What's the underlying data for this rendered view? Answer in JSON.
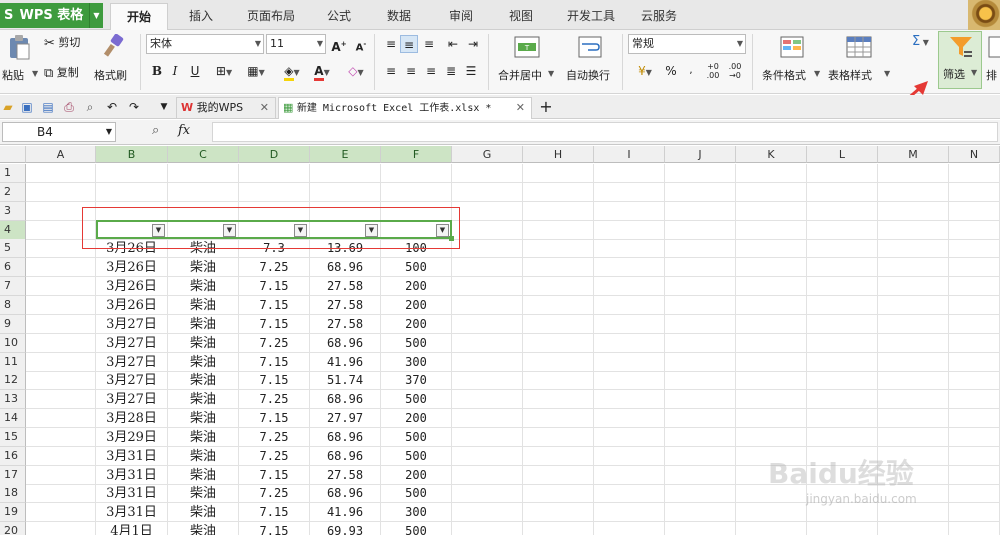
{
  "app": {
    "name": "WPS 表格"
  },
  "menu_tabs": [
    "开始",
    "插入",
    "页面布局",
    "公式",
    "数据",
    "审阅",
    "视图",
    "开发工具",
    "云服务"
  ],
  "ribbon": {
    "paste": "粘贴",
    "cut": "剪切",
    "copy": "复制",
    "format_painter": "格式刷",
    "font_name": "宋体",
    "font_size": "11",
    "merge_center": "合并居中",
    "wrap_text": "自动换行",
    "number_format": "常规",
    "conditional_format": "条件格式",
    "table_style": "表格样式",
    "sum_symbol": "Σ",
    "filter": "筛选",
    "sort": "排"
  },
  "quickbar": {
    "doc_tabs": [
      "我的WPS",
      "新建 Microsoft Excel 工作表.xlsx *"
    ],
    "add_tab": "+"
  },
  "formula_bar": {
    "cell_ref": "B4",
    "fx": "fx"
  },
  "grid": {
    "columns": [
      "A",
      "B",
      "C",
      "D",
      "E",
      "F",
      "G",
      "H",
      "I",
      "J",
      "K",
      "L",
      "M",
      "N"
    ],
    "rows": [
      "1",
      "2",
      "3",
      "4",
      "5",
      "6",
      "7",
      "8",
      "9",
      "10",
      "11",
      "12",
      "13",
      "14",
      "15",
      "16",
      "17",
      "18",
      "19",
      "20"
    ],
    "data_rows": [
      [
        "3月26日",
        "柴油",
        "7.3",
        "13.69",
        "100"
      ],
      [
        "3月26日",
        "柴油",
        "7.25",
        "68.96",
        "500"
      ],
      [
        "3月26日",
        "柴油",
        "7.15",
        "27.58",
        "200"
      ],
      [
        "3月26日",
        "柴油",
        "7.15",
        "27.58",
        "200"
      ],
      [
        "3月27日",
        "柴油",
        "7.15",
        "27.58",
        "200"
      ],
      [
        "3月27日",
        "柴油",
        "7.25",
        "68.96",
        "500"
      ],
      [
        "3月27日",
        "柴油",
        "7.15",
        "41.96",
        "300"
      ],
      [
        "3月27日",
        "柴油",
        "7.15",
        "51.74",
        "370"
      ],
      [
        "3月27日",
        "柴油",
        "7.25",
        "68.96",
        "500"
      ],
      [
        "3月28日",
        "柴油",
        "7.15",
        "27.97",
        "200"
      ],
      [
        "3月29日",
        "柴油",
        "7.25",
        "68.96",
        "500"
      ],
      [
        "3月31日",
        "柴油",
        "7.25",
        "68.96",
        "500"
      ],
      [
        "3月31日",
        "柴油",
        "7.15",
        "27.58",
        "200"
      ],
      [
        "3月31日",
        "柴油",
        "7.25",
        "68.96",
        "500"
      ],
      [
        "3月31日",
        "柴油",
        "7.15",
        "41.96",
        "300"
      ],
      [
        "4月1日",
        "柴油",
        "7.15",
        "69.93",
        "500"
      ]
    ]
  },
  "watermark": {
    "brand": "Baidu经验",
    "url": "jingyan.baidu.com"
  },
  "colors": {
    "accent_green": "#3e9b3e",
    "selection_green": "#5aaa4a",
    "annotation_red": "#e53935",
    "header_selected": "#cde4c5"
  }
}
